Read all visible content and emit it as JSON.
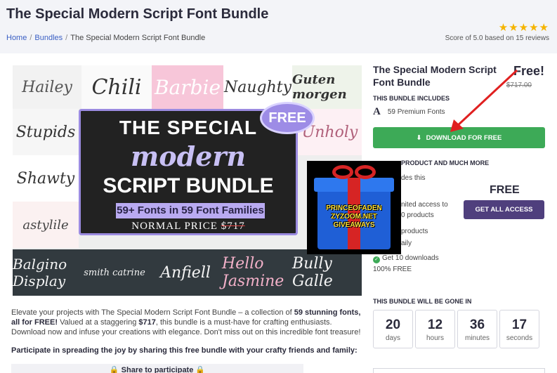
{
  "header": {
    "title": "The Special Modern Script Font Bundle",
    "stars": "★★★★★",
    "score_text": "Score of 5.0 based on 15 reviews",
    "breadcrumb": [
      "Home",
      "Bundles",
      "The Special Modern Script Font Bundle"
    ]
  },
  "hero": {
    "tiles": [
      "Hailey",
      "Chili",
      "Barbie",
      "Naughty",
      "Guten morgen",
      "Stupids",
      "Unholy",
      "Shawty",
      "astylile",
      "Balgino Display",
      "smith catrine",
      "Anfiell",
      "Hello Jasmine",
      "Bully Galle"
    ],
    "line1": "THE SPECIAL",
    "line2": "modern",
    "line3": "SCRIPT BUNDLE",
    "band": "59+ Fonts in 59 Font Families",
    "price_prefix": "NORMAL PRICE",
    "price": "$717",
    "badge": "FREE"
  },
  "sidebar": {
    "title": "The Special Modern Script Font Bundle",
    "price_free": "Free!",
    "price_old": "$717.00",
    "includes_heading": "THIS BUNDLE INCLUDES",
    "fonts_count": "59 Premium Fonts",
    "download_label": "DOWNLOAD FOR FREE",
    "more_heading": "PRODUCT AND MUCH MORE",
    "lines": [
      "des this",
      "nited access to",
      "0 products",
      "products",
      "aily"
    ],
    "free_label": "FREE",
    "access_label": "GET ALL ACCESS",
    "downloads_text": "Get 10 downloads",
    "free_percent": "100% FREE",
    "gone_heading": "THIS BUNDLE WILL BE GONE IN",
    "countdown": [
      {
        "value": "20",
        "unit": "days"
      },
      {
        "value": "12",
        "unit": "hours"
      },
      {
        "value": "36",
        "unit": "minutes"
      },
      {
        "value": "17",
        "unit": "seconds"
      }
    ]
  },
  "giveaway": {
    "lines": [
      "PRINCEOFADEN",
      "ZYZOOM.NET",
      "GIVEAWAYS"
    ]
  },
  "description": {
    "p1": "Elevate your projects with The Special Modern Script Font Bundle – a collection of ",
    "p1_bold": "59 stunning fonts, all for FREE!",
    "p2": " Valued at a staggering ",
    "p2_bold": "$717",
    "p3": ", this bundle is a must-have for crafting enthusiasts. Download now and infuse your creations with elegance. Don't miss out on this incredible font treasure!",
    "participate": "Participate in spreading the joy by sharing this free bundle with your crafty friends and family:",
    "share": "Share to participate"
  },
  "colors": {
    "accent_green": "#3daa57",
    "accent_purple": "#4f3f7d",
    "star": "#f5b400",
    "arrow": "#e02020"
  }
}
